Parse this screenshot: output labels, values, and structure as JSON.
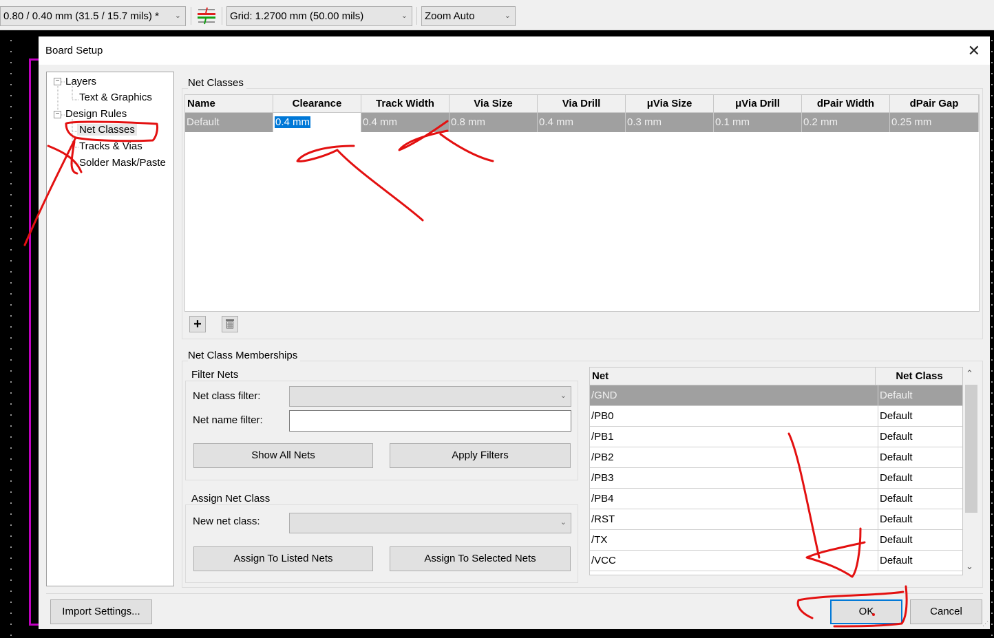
{
  "toolbar": {
    "track_width_select": "0.80 / 0.40 mm (31.5 / 15.7 mils) *",
    "grid_select": "Grid: 1.2700 mm (50.00 mils)",
    "zoom_select": "Zoom Auto",
    "chevron": "⌄"
  },
  "dialog": {
    "title": "Board Setup",
    "close_glyph": "✕",
    "tree": {
      "expand_glyph": "−",
      "items": [
        {
          "label": "Layers"
        },
        {
          "label": "Text & Graphics"
        },
        {
          "label": "Design Rules"
        },
        {
          "label": "Net Classes"
        },
        {
          "label": "Tracks & Vias"
        },
        {
          "label": "Solder Mask/Paste"
        }
      ]
    },
    "net_classes": {
      "group_label": "Net Classes",
      "columns": [
        "Name",
        "Clearance",
        "Track Width",
        "Via Size",
        "Via Drill",
        "μVia Size",
        "μVia Drill",
        "dPair Width",
        "dPair Gap"
      ],
      "rows": [
        [
          "Default",
          "0.4 mm",
          "0.4 mm",
          "0.8 mm",
          "0.4 mm",
          "0.3 mm",
          "0.1 mm",
          "0.2 mm",
          "0.25 mm"
        ]
      ],
      "add_glyph": "+",
      "delete_glyph": "🗑"
    },
    "memberships": {
      "group_label": "Net Class Memberships",
      "filter": {
        "group_label": "Filter Nets",
        "net_class_filter_label": "Net class filter:",
        "net_class_filter_value": "",
        "net_name_filter_label": "Net name filter:",
        "net_name_filter_value": "",
        "show_all_button": "Show All Nets",
        "apply_button": "Apply Filters"
      },
      "assign": {
        "group_label": "Assign Net Class",
        "new_class_label": "New net class:",
        "new_class_value": "",
        "assign_listed_button": "Assign To Listed Nets",
        "assign_selected_button": "Assign To Selected Nets"
      },
      "nets_table": {
        "columns": [
          "Net",
          "Net Class"
        ],
        "rows": [
          {
            "net": "/GND",
            "class": "Default"
          },
          {
            "net": "/PB0",
            "class": "Default"
          },
          {
            "net": "/PB1",
            "class": "Default"
          },
          {
            "net": "/PB2",
            "class": "Default"
          },
          {
            "net": "/PB3",
            "class": "Default"
          },
          {
            "net": "/PB4",
            "class": "Default"
          },
          {
            "net": "/RST",
            "class": "Default"
          },
          {
            "net": "/TX",
            "class": "Default"
          },
          {
            "net": "/VCC",
            "class": "Default"
          }
        ],
        "scroll_up": "⌃",
        "scroll_down": "⌄"
      }
    },
    "footer": {
      "import_button": "Import Settings...",
      "ok_button": "OK",
      "cancel_button": "Cancel"
    }
  },
  "colors": {
    "annotation": "#e31010",
    "board_outline": "#c000c0",
    "selection": "#0078d7",
    "selected_row": "#a0a0a0"
  }
}
